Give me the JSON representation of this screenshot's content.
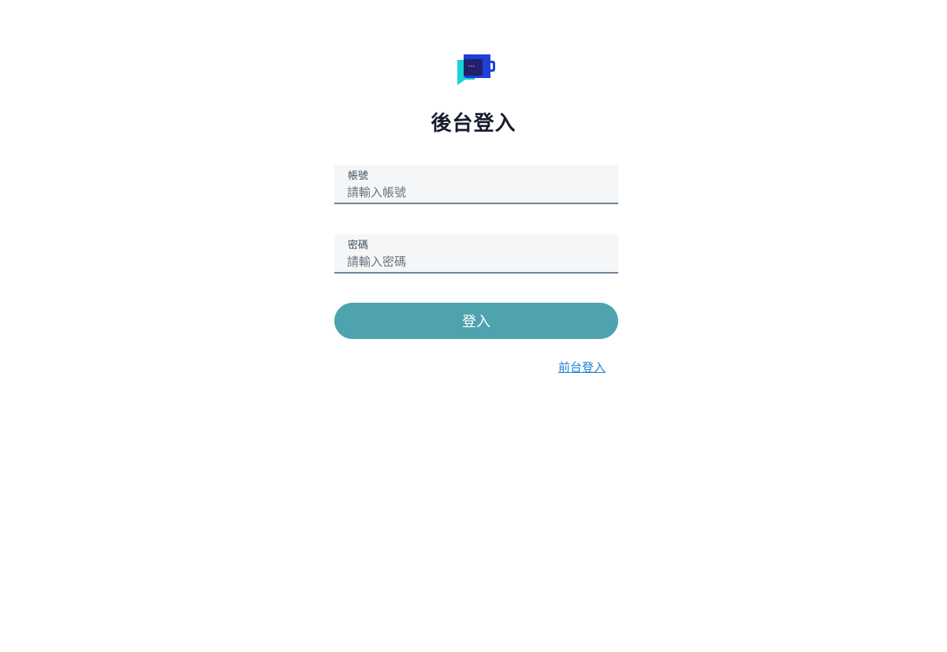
{
  "page": {
    "title": "後台登入"
  },
  "logo": {
    "icon": "chat-cup-logo-icon",
    "bubble_text": "···",
    "colors": {
      "cyan": "#1ad3d6",
      "blue": "#1f3fd6",
      "navy": "#22206b"
    }
  },
  "form": {
    "account": {
      "label": "帳號",
      "value": "",
      "placeholder": "請輸入帳號"
    },
    "password": {
      "label": "密碼",
      "value": "",
      "placeholder": "請輸入密碼"
    },
    "submit_label": "登入"
  },
  "links": {
    "frontend_login": "前台登入"
  },
  "colors": {
    "button": "#4fa3ae",
    "link": "#1f7fd6",
    "field_bg": "#f4f6f8",
    "field_border": "#6e8396"
  }
}
